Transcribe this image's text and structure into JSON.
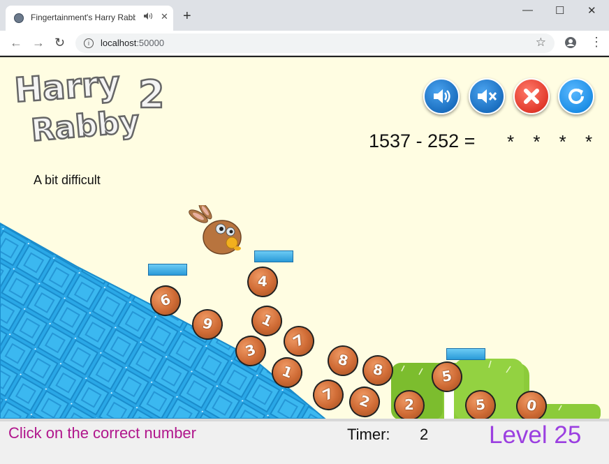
{
  "browser": {
    "tab_title": "Fingertainment's Harry Rabby 2",
    "tab_audio_icon": "speaker-icon",
    "tab_close": "✕",
    "new_tab": "+",
    "window_minimize": "—",
    "window_maximize": "☐",
    "window_close": "✕",
    "nav_back": "←",
    "nav_forward": "→",
    "nav_reload": "↻",
    "url_host": "localhost",
    "url_port": ":50000",
    "menu_icon": "⋮"
  },
  "game": {
    "logo_line1": "Harry",
    "logo_line2": "Rabby",
    "logo_number": "2",
    "equation": "1537 - 252 =",
    "answer_mask": "* * * *",
    "difficulty": "A bit difficult",
    "controls": [
      {
        "name": "sound-on-button",
        "icon": "speaker-icon",
        "color": "#1b6fc0"
      },
      {
        "name": "sound-mute-button",
        "icon": "mute-icon",
        "color": "#1b6fc0"
      },
      {
        "name": "close-game-button",
        "icon": "close-icon",
        "color": "#e23a2c"
      },
      {
        "name": "restart-button",
        "icon": "restart-icon",
        "color": "#1e8fe6"
      }
    ],
    "balls": [
      "6",
      "9",
      "4",
      "1",
      "3",
      "7",
      "1",
      "8",
      "8",
      "5",
      "7",
      "2",
      "2",
      "5",
      "0"
    ]
  },
  "status": {
    "hint": "Click on the correct number",
    "timer_label": "Timer:",
    "timer_value": "2",
    "level": "Level 25"
  },
  "colors": {
    "game_bg": "#fffde2",
    "ramp_blue": "#2aa7e6",
    "grass_green": "#8ccb3a",
    "ball_orange": "#cf6b35",
    "hint_magenta": "#b0168c",
    "level_purple": "#9b3fe0"
  }
}
